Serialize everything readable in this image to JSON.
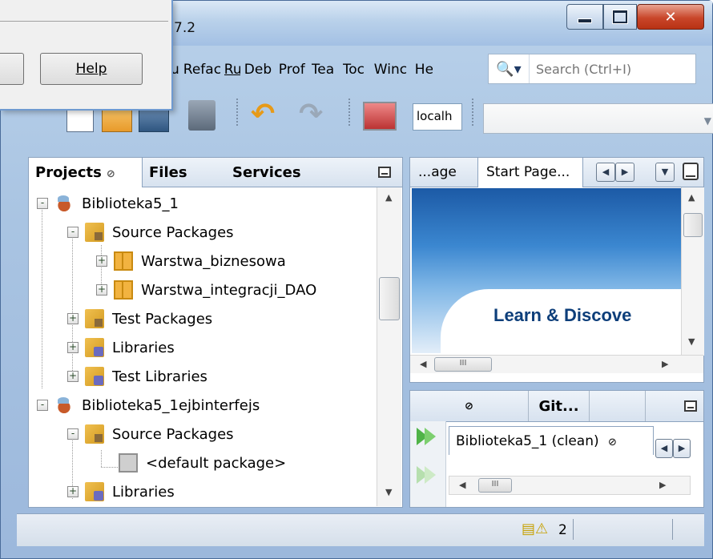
{
  "window": {
    "title_fragment": "7.2"
  },
  "menubar": {
    "items": [
      "u",
      "Refac",
      "Ru",
      "Deb",
      "Prof",
      "Tea",
      "Toc",
      "Winc",
      "He"
    ]
  },
  "search": {
    "placeholder": "Search (Ctrl+I)"
  },
  "toolbar": {
    "server_combo": "localh",
    "config_combo": ""
  },
  "projects_panel": {
    "tabs": [
      {
        "label": "Projects",
        "close": "⊘",
        "active": true
      },
      {
        "label": "Files",
        "active": false
      },
      {
        "label": "Services",
        "active": false
      }
    ],
    "tree": [
      {
        "label": "Biblioteka5_1",
        "level": 0,
        "icon": "project-icon",
        "expander": "-"
      },
      {
        "label": "Source Packages",
        "level": 1,
        "icon": "source-folder-icon",
        "expander": "-"
      },
      {
        "label": "Warstwa_biznesowa",
        "level": 2,
        "icon": "package-icon",
        "expander": "+"
      },
      {
        "label": "Warstwa_integracji_DAO",
        "level": 2,
        "icon": "package-icon",
        "expander": "+"
      },
      {
        "label": "Test Packages",
        "level": 1,
        "icon": "source-folder-icon",
        "expander": "+"
      },
      {
        "label": "Libraries",
        "level": 1,
        "icon": "library-folder-icon",
        "expander": "+"
      },
      {
        "label": "Test Libraries",
        "level": 1,
        "icon": "library-folder-icon",
        "expander": "+"
      },
      {
        "label": "Biblioteka5_1ejbinterfejs",
        "level": 0,
        "icon": "project-icon",
        "expander": "-"
      },
      {
        "label": "Source Packages",
        "level": 1,
        "icon": "source-folder-icon",
        "expander": "-"
      },
      {
        "label": "<default package>",
        "level": 2,
        "icon": "empty-package-icon",
        "expander": ""
      },
      {
        "label": "Libraries",
        "level": 1,
        "icon": "library-folder-icon",
        "expander": "+"
      }
    ]
  },
  "editor_panel": {
    "tabs": [
      "...age",
      "Start Page..."
    ],
    "banner_text": "Learn & Discove",
    "hscroll_grip": "III"
  },
  "output_panel": {
    "tabs": [
      "⊘",
      "Git..."
    ],
    "output_tab": "Biblioteka5_1 (clean)",
    "output_tab_close": "⊘",
    "hscroll_grip": "III"
  },
  "statusbar": {
    "notification_count": "2"
  },
  "dialog": {
    "help_label": "Help"
  },
  "colors": {
    "window_frame": "#a9c4e2",
    "close_button": "#c9462a",
    "panel_border": "#8ca3bf"
  }
}
